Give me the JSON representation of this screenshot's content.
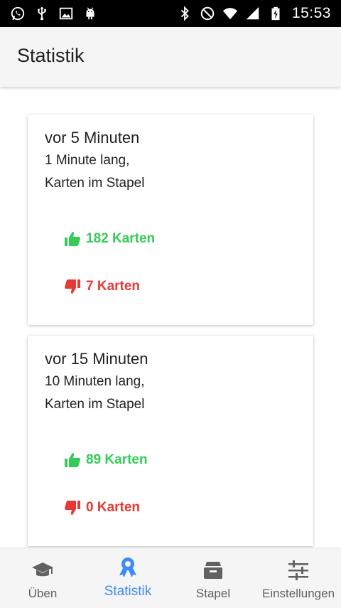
{
  "status_bar": {
    "time": "15:53",
    "left_icons": [
      "whatsapp-icon",
      "usb-icon",
      "image-icon",
      "android-icon"
    ],
    "right_icons": [
      "bluetooth-icon",
      "do-not-disturb-icon",
      "wifi-icon",
      "signal-icon",
      "battery-charging-icon"
    ]
  },
  "app_bar": {
    "title": "Statistik"
  },
  "sessions": [
    {
      "time_ago": "vor 5 Minuten",
      "duration": "1 Minute lang,",
      "source": "Karten im Stapel",
      "correct": "182 Karten",
      "wrong": "7 Karten"
    },
    {
      "time_ago": "vor 15 Minuten",
      "duration": "10 Minuten lang,",
      "source": "Karten im Stapel",
      "correct": "89 Karten",
      "wrong": "0 Karten"
    }
  ],
  "bottom_nav": {
    "active": "Statistik",
    "items": [
      {
        "label": "Üben",
        "icon": "graduation-cap-icon"
      },
      {
        "label": "Statistik",
        "icon": "award-ribbon-icon"
      },
      {
        "label": "Stapel",
        "icon": "inbox-tray-icon"
      },
      {
        "label": "Einstellungen",
        "icon": "sliders-icon"
      }
    ]
  },
  "colors": {
    "correct": "#33cc55",
    "wrong": "#e53935",
    "active_nav": "#3d8bf7",
    "app_bar_bg": "#f5f5f5",
    "status_bar_bg": "#000000"
  }
}
